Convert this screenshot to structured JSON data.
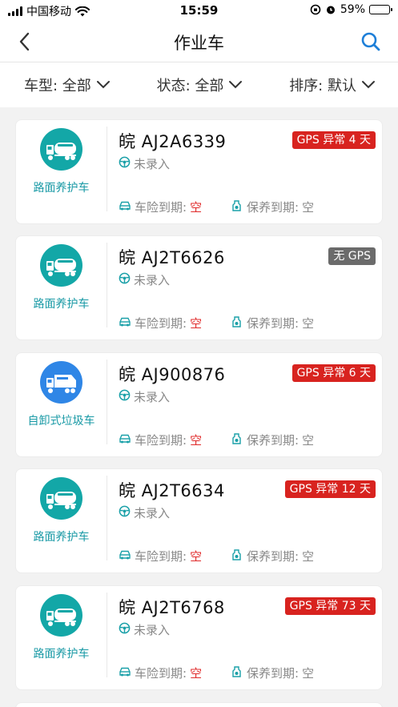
{
  "status_bar": {
    "carrier": "中国移动",
    "time": "15:59",
    "battery": "59%",
    "battery_level": 0.59,
    "battery_color": "#35c759"
  },
  "nav": {
    "title": "作业车",
    "back_icon": "chevron-left-icon",
    "search_icon": "search-icon",
    "accent": "#1e7fd8"
  },
  "filters": [
    {
      "label": "车型: 全部"
    },
    {
      "label": "状态: 全部"
    },
    {
      "label": "排序: 默认"
    }
  ],
  "vehicles": [
    {
      "type": "路面养护车",
      "icon_color": "#13a7a7",
      "plate": "皖 AJ2A6339",
      "gps": "GPS 异常 4 天",
      "gps_color": "#d8231f",
      "driver": "未录入",
      "insurance_label": "车险到期:",
      "insurance": "空",
      "maintenance_label": "保养到期:",
      "maintenance": "空"
    },
    {
      "type": "路面养护车",
      "icon_color": "#13a7a7",
      "plate": "皖 AJ2T6626",
      "gps": "无 GPS",
      "gps_color": "#6b6b6b",
      "driver": "未录入",
      "insurance_label": "车险到期:",
      "insurance": "空",
      "maintenance_label": "保养到期:",
      "maintenance": "空"
    },
    {
      "type": "自卸式垃圾车",
      "icon_color": "#2f86e6",
      "plate": "皖 AJ900876",
      "gps": "GPS 异常 6 天",
      "gps_color": "#d8231f",
      "driver": "未录入",
      "insurance_label": "车险到期:",
      "insurance": "空",
      "maintenance_label": "保养到期:",
      "maintenance": "空"
    },
    {
      "type": "路面养护车",
      "icon_color": "#13a7a7",
      "plate": "皖 AJ2T6634",
      "gps": "GPS 异常 12 天",
      "gps_color": "#d8231f",
      "driver": "未录入",
      "insurance_label": "车险到期:",
      "insurance": "空",
      "maintenance_label": "保养到期:",
      "maintenance": "空"
    },
    {
      "type": "路面养护车",
      "icon_color": "#13a7a7",
      "plate": "皖 AJ2T6768",
      "gps": "GPS 异常 73 天",
      "gps_color": "#d8231f",
      "driver": "未录入",
      "insurance_label": "车险到期:",
      "insurance": "空",
      "maintenance_label": "保养到期:",
      "maintenance": "空"
    }
  ]
}
